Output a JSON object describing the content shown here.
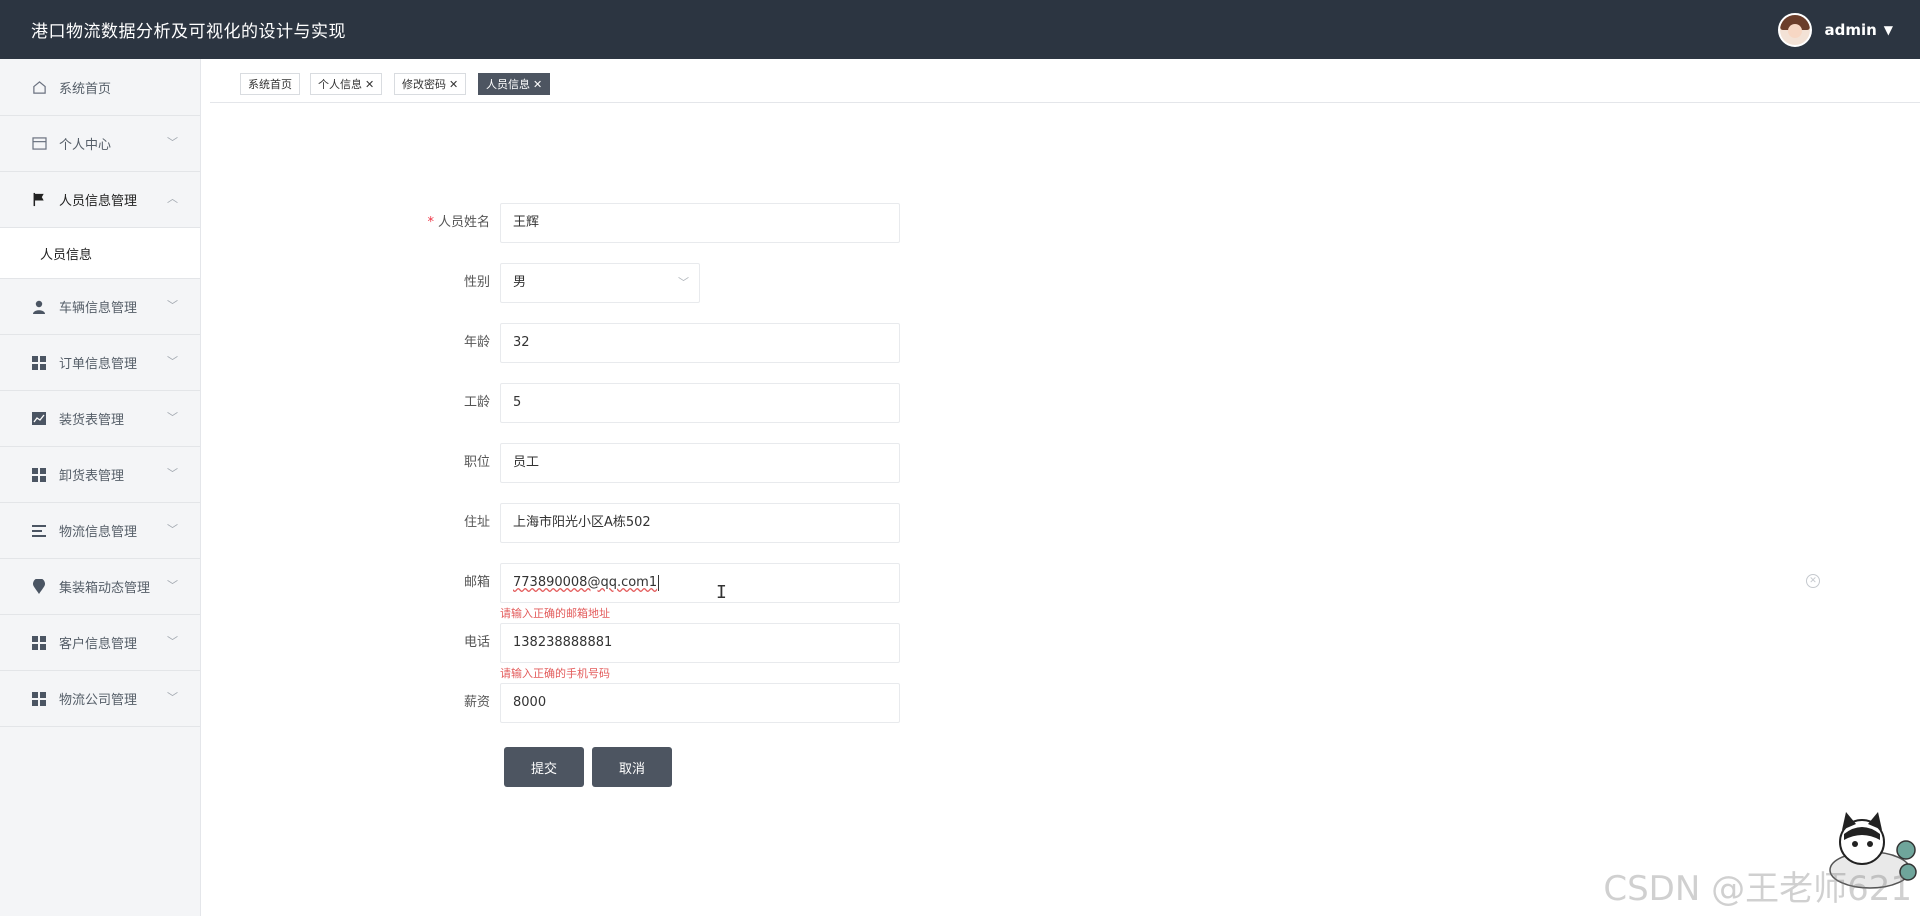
{
  "app": {
    "title": "港口物流数据分析及可视化的设计与实现"
  },
  "user": {
    "name": "admin"
  },
  "sidebar": {
    "items": [
      {
        "label": "系统首页",
        "icon": "home-icon",
        "expandable": false
      },
      {
        "label": "个人中心",
        "icon": "card-icon",
        "expandable": true
      },
      {
        "label": "人员信息管理",
        "icon": "flag-icon",
        "expandable": true,
        "expanded": true
      },
      {
        "label": "车辆信息管理",
        "icon": "user-icon",
        "expandable": true
      },
      {
        "label": "订单信息管理",
        "icon": "grid-icon",
        "expandable": true
      },
      {
        "label": "装货表管理",
        "icon": "chart-icon",
        "expandable": true
      },
      {
        "label": "卸货表管理",
        "icon": "grid-icon",
        "expandable": true
      },
      {
        "label": "物流信息管理",
        "icon": "list-icon",
        "expandable": true
      },
      {
        "label": "集装箱动态管理",
        "icon": "pin-icon",
        "expandable": true
      },
      {
        "label": "客户信息管理",
        "icon": "grid-icon",
        "expandable": true
      },
      {
        "label": "物流公司管理",
        "icon": "grid-icon",
        "expandable": true
      }
    ],
    "submenu": {
      "label": "人员信息"
    }
  },
  "tabs": [
    {
      "label": "系统首页",
      "closable": false,
      "active": false
    },
    {
      "label": "个人信息",
      "closable": true,
      "active": false
    },
    {
      "label": "修改密码",
      "closable": true,
      "active": false
    },
    {
      "label": "人员信息",
      "closable": true,
      "active": true
    }
  ],
  "form": {
    "name": {
      "label": "人员姓名",
      "required": true,
      "value": "王辉"
    },
    "gender": {
      "label": "性别",
      "value": "男"
    },
    "age": {
      "label": "年龄",
      "value": "32"
    },
    "seniority": {
      "label": "工龄",
      "value": "5"
    },
    "position": {
      "label": "职位",
      "value": "员工"
    },
    "address": {
      "label": "住址",
      "value": "上海市阳光小区A栋502"
    },
    "email": {
      "label": "邮箱",
      "value": "773890008@qq.com1",
      "error": "请输入正确的邮箱地址"
    },
    "phone": {
      "label": "电话",
      "value": "138238888881",
      "error": "请输入正确的手机号码"
    },
    "salary": {
      "label": "薪资",
      "value": "8000"
    },
    "submit_label": "提交",
    "cancel_label": "取消"
  },
  "watermark": "CSDN @王老师621",
  "colors": {
    "topbar": "#2c3541",
    "button": "#4d5561",
    "error": "#e35b5b"
  }
}
